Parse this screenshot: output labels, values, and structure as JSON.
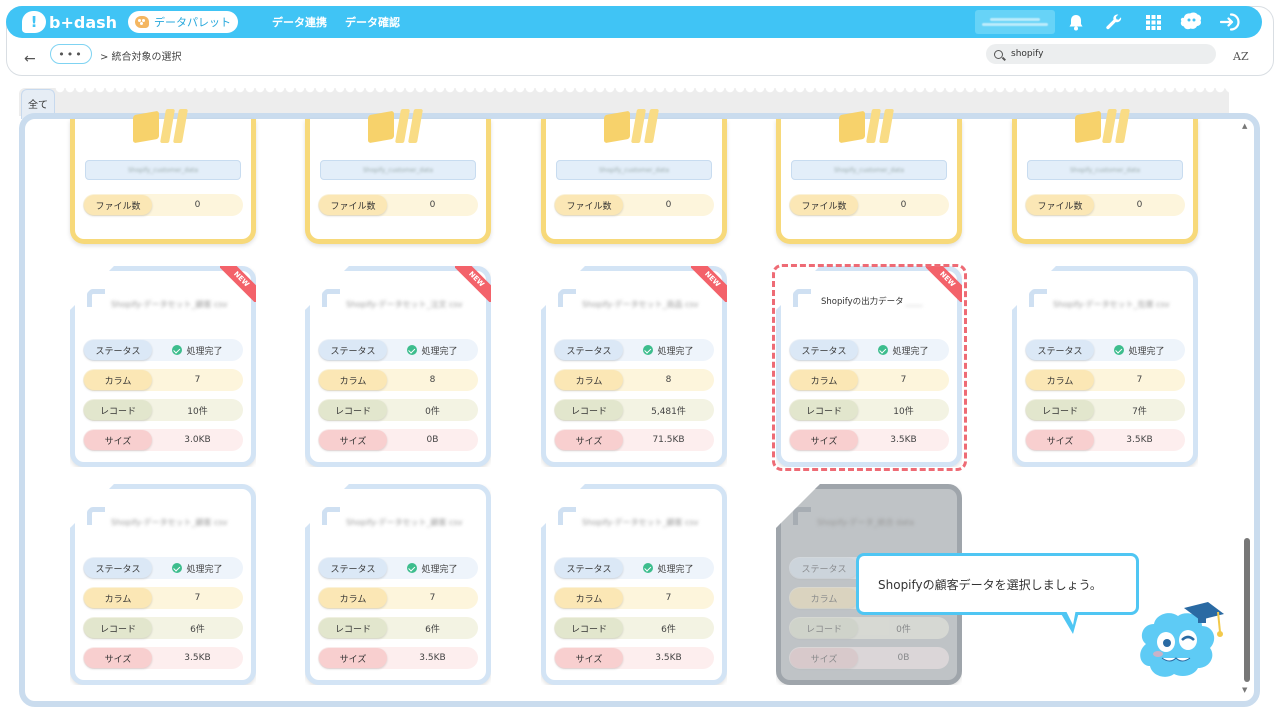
{
  "header": {
    "logo_text": "b+dash",
    "logo_mark": "!",
    "palette_label": "データパレット",
    "nav": [
      "データ連携",
      "データ確認"
    ]
  },
  "subbar": {
    "back_icon": "←",
    "dots_label": "•••",
    "breadcrumb": "> 統合対象の選択",
    "search_value": "shopify",
    "sort_label": "AZ"
  },
  "tab": {
    "label": "全て"
  },
  "labels": {
    "status": "ステータス",
    "column": "カラム",
    "record": "レコード",
    "size": "サイズ",
    "files": "ファイル数",
    "new": "NEW",
    "done": "処理完了"
  },
  "folders": [
    {
      "name": "Shopify_customer_data",
      "files": "0"
    },
    {
      "name": "Shopify_customer_data",
      "files": "0"
    },
    {
      "name": "Shopify_customer_data",
      "files": "0"
    },
    {
      "name": "Shopify_customer_data",
      "files": "0"
    },
    {
      "name": "Shopify_customer_data",
      "files": "0"
    }
  ],
  "cards": [
    {
      "title": "Shopify-データセット_顧客 csv",
      "column": "7",
      "record": "10件",
      "size": "3.0KB",
      "new": true
    },
    {
      "title": "Shopify-データセット_注文 csv",
      "column": "8",
      "record": "0件",
      "size": "0B",
      "new": true
    },
    {
      "title": "Shopify-データセット_商品 csv",
      "column": "8",
      "record": "5,481件",
      "size": "71.5KB",
      "new": true
    },
    {
      "title": "Shopifyの出力データ",
      "column": "7",
      "record": "10件",
      "size": "3.5KB",
      "new": true,
      "selected": true
    },
    {
      "title": "Shopify-データセット_在庫 csv",
      "column": "7",
      "record": "7件",
      "size": "3.5KB",
      "new": false
    },
    {
      "title": "Shopify-データセット_顧客 csv",
      "column": "7",
      "record": "6件",
      "size": "3.5KB",
      "new": false
    },
    {
      "title": "Shopify-データセット_顧客 csv",
      "column": "7",
      "record": "6件",
      "size": "3.5KB",
      "new": false
    },
    {
      "title": "Shopify-データセット_顧客 csv",
      "column": "7",
      "record": "6件",
      "size": "3.5KB",
      "new": false
    },
    {
      "title": "Shopify-データ_統合 data",
      "column": "7",
      "record": "0件",
      "size": "0B",
      "new": false,
      "disabled": true
    }
  ],
  "tooltip": {
    "text": "Shopifyの顧客データを選択しましょう。"
  },
  "colors": {
    "accent": "#40c4f5",
    "selection": "#ee6b75",
    "folder": "#f7d97a"
  }
}
